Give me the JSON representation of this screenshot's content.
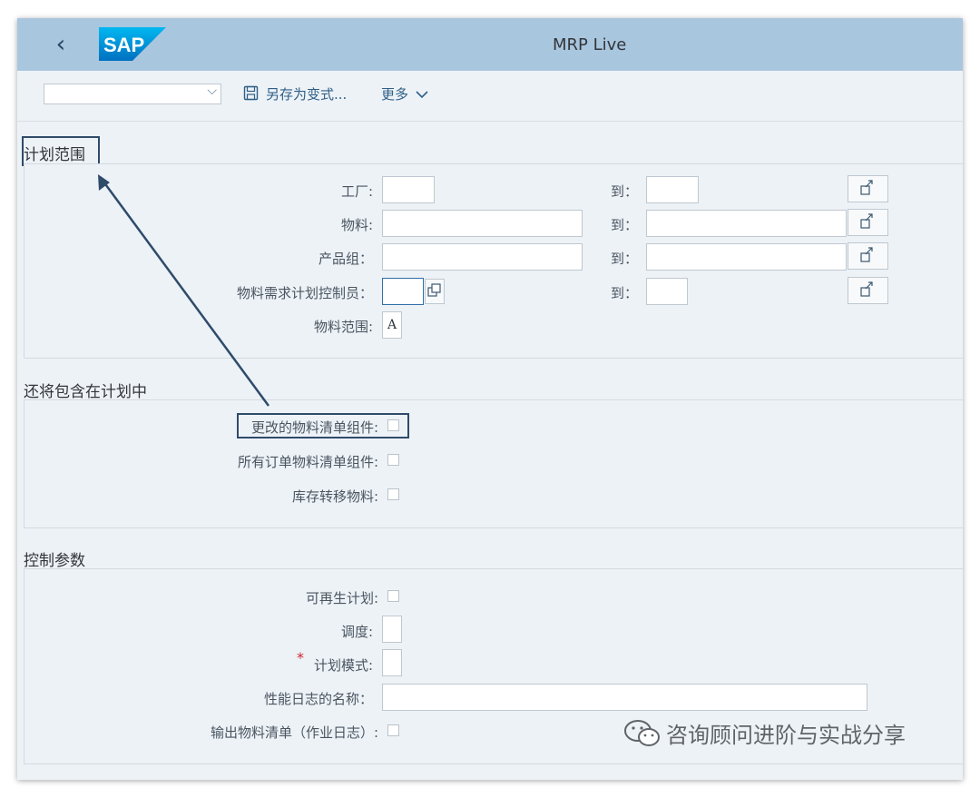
{
  "shell": {
    "title": "MRP Live",
    "logo_text": "SAP"
  },
  "toolbar": {
    "variant_value": "",
    "save_as_variant": "另存为变式...",
    "more": "更多"
  },
  "section1": {
    "title": "计划范围",
    "to_label": "到：",
    "rows": [
      {
        "label": "工厂:",
        "from": "",
        "to": ""
      },
      {
        "label": "物料:",
        "from": "",
        "to": ""
      },
      {
        "label": "产品组：",
        "from": "",
        "to": ""
      },
      {
        "label": "物料需求计划控制员：",
        "from": "",
        "to": ""
      }
    ],
    "material_scope_label": "物料范围:",
    "material_scope_value": "A"
  },
  "section2": {
    "title": "还将包含在计划中",
    "items": [
      "更改的物料清单组件:",
      "所有订单物料清单组件:",
      "库存转移物料:"
    ]
  },
  "section3": {
    "title": "控制参数",
    "regenerative": "可再生计划:",
    "scheduling": "调度:",
    "scheduling_value": "",
    "planning_mode_required": "*",
    "planning_mode": "计划模式:",
    "planning_mode_value": "",
    "log_name": "性能日志的名称：",
    "log_name_value": "",
    "output_bom": "输出物料清单（作业日志）:"
  },
  "watermark": "咨询顾问进阶与实战分享",
  "colors": {
    "shell_bg": "#a9c6df",
    "page_bg": "#edf2f7",
    "highlight": "#2f4b6a",
    "link": "#2f5f86"
  }
}
